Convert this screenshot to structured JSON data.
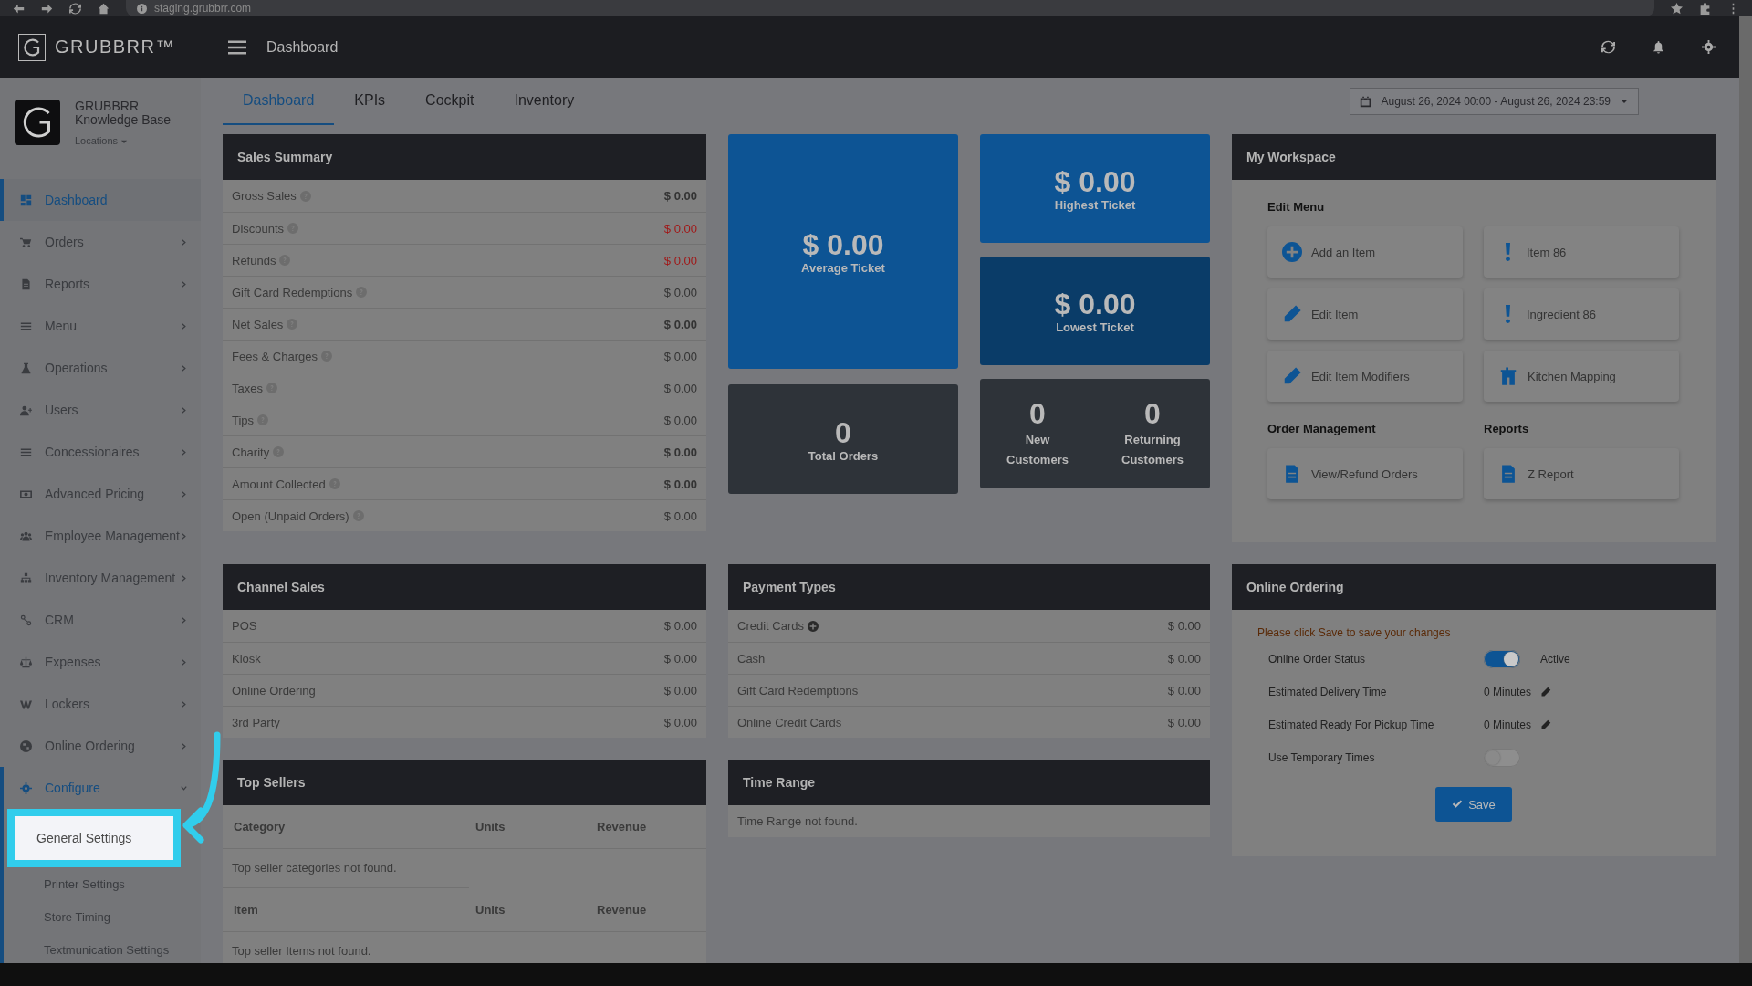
{
  "browser": {
    "url": "staging.grubbrr.com"
  },
  "brand": {
    "name": "GRUBBRR™"
  },
  "header": {
    "title": "Dashboard"
  },
  "profile": {
    "name": "GRUBBRR",
    "subtitle": "Knowledge Base",
    "locations": "Locations"
  },
  "sidebar": {
    "items": [
      {
        "label": "Dashboard",
        "selected": true,
        "expandable": false,
        "expanded": false
      },
      {
        "label": "Orders",
        "selected": false,
        "expandable": true,
        "expanded": false
      },
      {
        "label": "Reports",
        "selected": false,
        "expandable": true,
        "expanded": false
      },
      {
        "label": "Menu",
        "selected": false,
        "expandable": true,
        "expanded": false
      },
      {
        "label": "Operations",
        "selected": false,
        "expandable": true,
        "expanded": false
      },
      {
        "label": "Users",
        "selected": false,
        "expandable": true,
        "expanded": false
      },
      {
        "label": "Concessionaires",
        "selected": false,
        "expandable": true,
        "expanded": false
      },
      {
        "label": "Advanced Pricing",
        "selected": false,
        "expandable": true,
        "expanded": false
      },
      {
        "label": "Employee Management",
        "selected": false,
        "expandable": true,
        "expanded": false
      },
      {
        "label": "Inventory Management",
        "selected": false,
        "expandable": true,
        "expanded": false
      },
      {
        "label": "CRM",
        "selected": false,
        "expandable": true,
        "expanded": false
      },
      {
        "label": "Expenses",
        "selected": false,
        "expandable": true,
        "expanded": false
      },
      {
        "label": "Lockers",
        "selected": false,
        "expandable": true,
        "expanded": false
      },
      {
        "label": "Online Ordering",
        "selected": false,
        "expandable": true,
        "expanded": false
      },
      {
        "label": "Configure",
        "selected": false,
        "expandable": true,
        "expanded": true,
        "children": [
          {
            "label": "General Settings",
            "highlighted": true
          },
          {
            "label": "Printer Settings",
            "highlighted": false
          },
          {
            "label": "Store Timing",
            "highlighted": false
          },
          {
            "label": "Textmunication Settings",
            "highlighted": false
          }
        ]
      }
    ]
  },
  "tabs": [
    {
      "label": "Dashboard",
      "selected": true
    },
    {
      "label": "KPIs",
      "selected": false
    },
    {
      "label": "Cockpit",
      "selected": false
    },
    {
      "label": "Inventory",
      "selected": false
    }
  ],
  "date_range": "August 26, 2024 00:00 - August 26, 2024 23:59",
  "sales_summary": {
    "title": "Sales Summary",
    "rows": [
      {
        "label": "Gross Sales",
        "value": "$ 0.00",
        "negative": false,
        "emphasis": true
      },
      {
        "label": "Discounts",
        "value": "$ 0.00",
        "negative": true,
        "emphasis": false
      },
      {
        "label": "Refunds",
        "value": "$ 0.00",
        "negative": true,
        "emphasis": false
      },
      {
        "label": "Gift Card Redemptions",
        "value": "$ 0.00",
        "negative": false,
        "emphasis": false
      },
      {
        "label": "Net Sales",
        "value": "$ 0.00",
        "negative": false,
        "emphasis": true
      },
      {
        "label": "Fees & Charges",
        "value": "$ 0.00",
        "negative": false,
        "emphasis": false
      },
      {
        "label": "Taxes",
        "value": "$ 0.00",
        "negative": false,
        "emphasis": false
      },
      {
        "label": "Tips",
        "value": "$ 0.00",
        "negative": false,
        "emphasis": false
      },
      {
        "label": "Charity",
        "value": "$ 0.00",
        "negative": false,
        "emphasis": true
      },
      {
        "label": "Amount Collected",
        "value": "$ 0.00",
        "negative": false,
        "emphasis": true
      },
      {
        "label": "Open (Unpaid Orders)",
        "value": "$ 0.00",
        "negative": false,
        "emphasis": false
      }
    ]
  },
  "stats": {
    "average": {
      "value": "$ 0.00",
      "label": "Average Ticket"
    },
    "highest": {
      "value": "$ 0.00",
      "label": "Highest Ticket"
    },
    "lowest": {
      "value": "$ 0.00",
      "label": "Lowest Ticket"
    },
    "total_orders": {
      "value": "0",
      "label": "Total Orders"
    },
    "customers": [
      {
        "value": "0",
        "label": "New Customers"
      },
      {
        "value": "0",
        "label": "Returning Customers"
      }
    ]
  },
  "workspace": {
    "title": "My Workspace",
    "edit_menu": {
      "heading": "Edit Menu",
      "items": [
        "Add an Item",
        "Item 86",
        "Edit Item",
        "Ingredient 86",
        "Edit Item Modifiers",
        "Kitchen Mapping"
      ]
    },
    "order_management": {
      "heading": "Order Management",
      "items": [
        "View/Refund Orders"
      ]
    },
    "reports": {
      "heading": "Reports",
      "items": [
        "Z Report"
      ]
    }
  },
  "channel_sales": {
    "title": "Channel Sales",
    "rows": [
      {
        "label": "POS",
        "value": "$ 0.00"
      },
      {
        "label": "Kiosk",
        "value": "$ 0.00"
      },
      {
        "label": "Online Ordering",
        "value": "$ 0.00"
      },
      {
        "label": "3rd Party",
        "value": "$ 0.00"
      }
    ]
  },
  "payment_types": {
    "title": "Payment Types",
    "rows": [
      {
        "label": "Credit Cards",
        "value": "$ 0.00",
        "expandable": true
      },
      {
        "label": "Cash",
        "value": "$ 0.00",
        "expandable": false
      },
      {
        "label": "Gift Card Redemptions",
        "value": "$ 0.00",
        "expandable": false
      },
      {
        "label": "Online Credit Cards",
        "value": "$ 0.00",
        "expandable": false
      }
    ]
  },
  "online_ordering": {
    "title": "Online Ordering",
    "notice": "Please click Save to save your changes",
    "status": {
      "label": "Online Order Status",
      "on": true,
      "state_label": "Active"
    },
    "delivery": {
      "label": "Estimated Delivery Time",
      "value": "0 Minutes"
    },
    "pickup": {
      "label": "Estimated Ready For Pickup Time",
      "value": "0 Minutes"
    },
    "temporary": {
      "label": "Use Temporary Times",
      "on": false
    },
    "save": "Save"
  },
  "top_sellers": {
    "title": "Top Sellers",
    "category_table": {
      "columns": [
        "Category",
        "Units",
        "Revenue"
      ],
      "empty": "Top seller categories not found."
    },
    "item_table": {
      "columns": [
        "Item",
        "Units",
        "Revenue"
      ],
      "empty": "Top seller Items not found."
    }
  },
  "time_range": {
    "title": "Time Range",
    "empty": "Time Range not found."
  }
}
